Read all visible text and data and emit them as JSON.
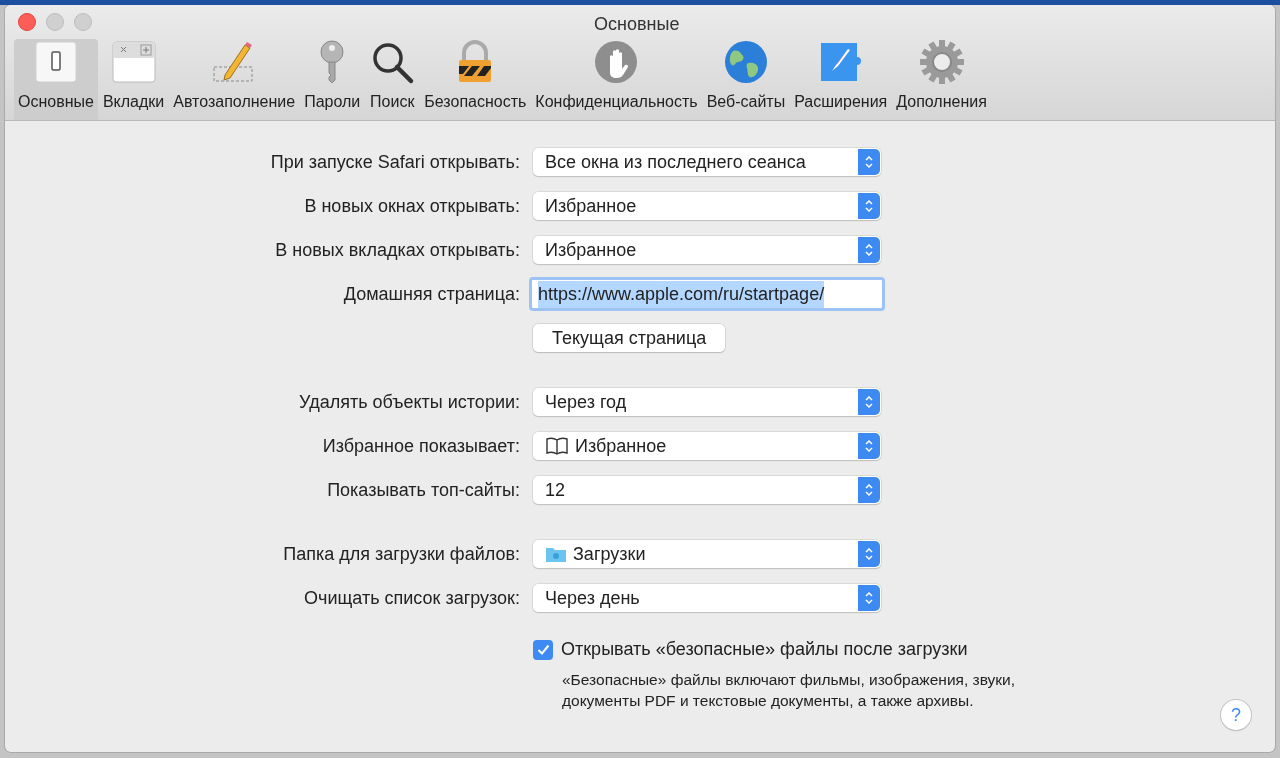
{
  "window": {
    "title": "Основные"
  },
  "toolbar": [
    {
      "kind": "general",
      "label": "Основные",
      "selected": true
    },
    {
      "kind": "tabs",
      "label": "Вкладки",
      "selected": false
    },
    {
      "kind": "autofill",
      "label": "Автозаполнение",
      "selected": false
    },
    {
      "kind": "passwords",
      "label": "Пароли",
      "selected": false
    },
    {
      "kind": "search",
      "label": "Поиск",
      "selected": false
    },
    {
      "kind": "security",
      "label": "Безопасность",
      "selected": false
    },
    {
      "kind": "privacy",
      "label": "Конфиденциальность",
      "selected": false
    },
    {
      "kind": "websites",
      "label": "Веб-сайты",
      "selected": false
    },
    {
      "kind": "extensions",
      "label": "Расширения",
      "selected": false
    },
    {
      "kind": "advanced",
      "label": "Дополнения",
      "selected": false
    }
  ],
  "sections": [
    {
      "rows": [
        {
          "kind": "select",
          "label": "При запуске Safari открывать:",
          "value": "Все окна из последнего сеанса"
        },
        {
          "kind": "select",
          "label": "В новых окнах открывать:",
          "value": "Избранное"
        },
        {
          "kind": "select",
          "label": "В новых вкладках открывать:",
          "value": "Избранное"
        },
        {
          "kind": "field",
          "label": "Домашняя страница:",
          "value": "https://www.apple.com/ru/startpage/",
          "focused": true
        },
        {
          "kind": "button",
          "label_button": "Текущая страница"
        }
      ]
    },
    {
      "rows": [
        {
          "kind": "select",
          "label": "Удалять объекты истории:",
          "value": "Через год"
        },
        {
          "kind": "bookmarks_select",
          "label": "Избранное показывает:",
          "value": "Избранное"
        },
        {
          "kind": "select",
          "label": "Показывать топ-сайты:",
          "value": "12"
        }
      ]
    },
    {
      "rows": [
        {
          "kind": "folder_select",
          "label": "Папка для загрузки файлов:",
          "value": "Загрузки"
        },
        {
          "kind": "select",
          "label": "Очищать список загрузок:",
          "value": "Через день"
        }
      ]
    }
  ],
  "safe_files": {
    "checked": true,
    "label": "Открывать «безопасные» файлы после загрузки",
    "note": "«Безопасные» файлы включают фильмы, изображения, звуки, документы PDF и текстовые документы, а также архивы."
  },
  "help": {
    "label": "?"
  }
}
